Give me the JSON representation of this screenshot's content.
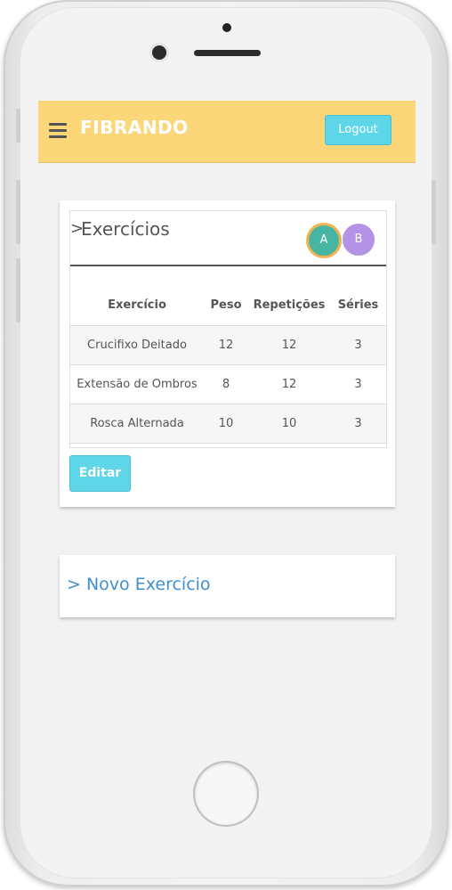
{
  "header": {
    "brand": "FIBRANDO",
    "logout_label": "Logout"
  },
  "exercises": {
    "chevron": ">",
    "title": "Exercícios",
    "avatars": [
      "A",
      "B"
    ],
    "columns": [
      "Exercício",
      "Peso",
      "Repetições",
      "Séries"
    ],
    "rows": [
      [
        "Crucifixo Deitado",
        "12",
        "12",
        "3"
      ],
      [
        "Extensão de Ombros",
        "8",
        "12",
        "3"
      ],
      [
        "Rosca Alternada",
        "10",
        "10",
        "3"
      ]
    ],
    "edit_label": "Editar"
  },
  "new_exercise": {
    "chevron": ">",
    "title": "Novo Exercício"
  },
  "colors": {
    "topbar": "#fcd77a",
    "button": "#5fd6e8",
    "avatar_a": "#46b6a3",
    "avatar_a_ring": "#f0b34d",
    "avatar_b": "#b493e6",
    "link": "#3d8fcf"
  }
}
